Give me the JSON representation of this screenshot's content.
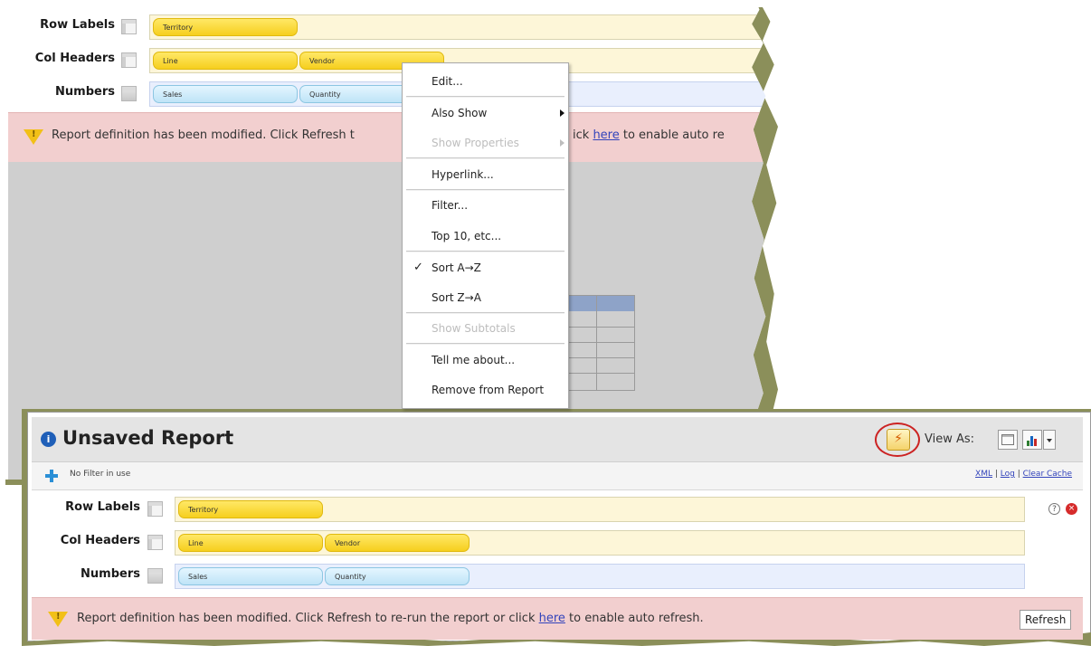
{
  "top_panel": {
    "fields": [
      {
        "label": "Row Labels",
        "chips": [
          "Territory"
        ]
      },
      {
        "label": "Col Headers",
        "chips": [
          "Line",
          "Vendor"
        ]
      },
      {
        "label": "Numbers",
        "chips": [
          "Sales",
          "Quantity"
        ]
      }
    ],
    "warning": {
      "before": "Report definition has been modified. Click Refresh t",
      "after_menu": "ick",
      "link": "here",
      "tail": "to enable auto re"
    }
  },
  "context_menu": {
    "items": [
      {
        "label": "Edit...",
        "enabled": true
      },
      {
        "label": "Also Show",
        "enabled": true,
        "submenu": true
      },
      {
        "label": "Show Properties",
        "enabled": false,
        "submenu": true
      },
      {
        "label": "Hyperlink...",
        "enabled": true
      },
      {
        "label": "Filter...",
        "enabled": true
      },
      {
        "label": "Top 10, etc...",
        "enabled": true
      },
      {
        "label": "Sort A→Z",
        "enabled": true,
        "checked": true
      },
      {
        "label": "Sort Z→A",
        "enabled": true
      },
      {
        "label": "Show Subtotals",
        "enabled": false
      },
      {
        "label": "Tell me about...",
        "enabled": true
      },
      {
        "label": "Remove from Report",
        "enabled": true
      }
    ]
  },
  "bottom_panel": {
    "title": "Unsaved Report",
    "view_as_label": "View As:",
    "filter_text": "No Filter in use",
    "links": [
      "XML",
      "Log",
      "Clear Cache"
    ],
    "fields": [
      {
        "label": "Row Labels",
        "chips": [
          "Territory"
        ]
      },
      {
        "label": "Col Headers",
        "chips": [
          "Line",
          "Vendor"
        ]
      },
      {
        "label": "Numbers",
        "chips": [
          "Sales",
          "Quantity"
        ]
      }
    ],
    "warning": {
      "before": "Report definition has been modified. Click Refresh to re-run the report or click",
      "link": "here",
      "after": "to enable auto refresh."
    },
    "refresh_label": "Refresh"
  },
  "colors": {
    "warning_bg": "#f2cfcf",
    "highlight_circle": "#cc2222",
    "yellow_chip": "#f6cf1e",
    "blue_chip": "#bfe4f7"
  }
}
